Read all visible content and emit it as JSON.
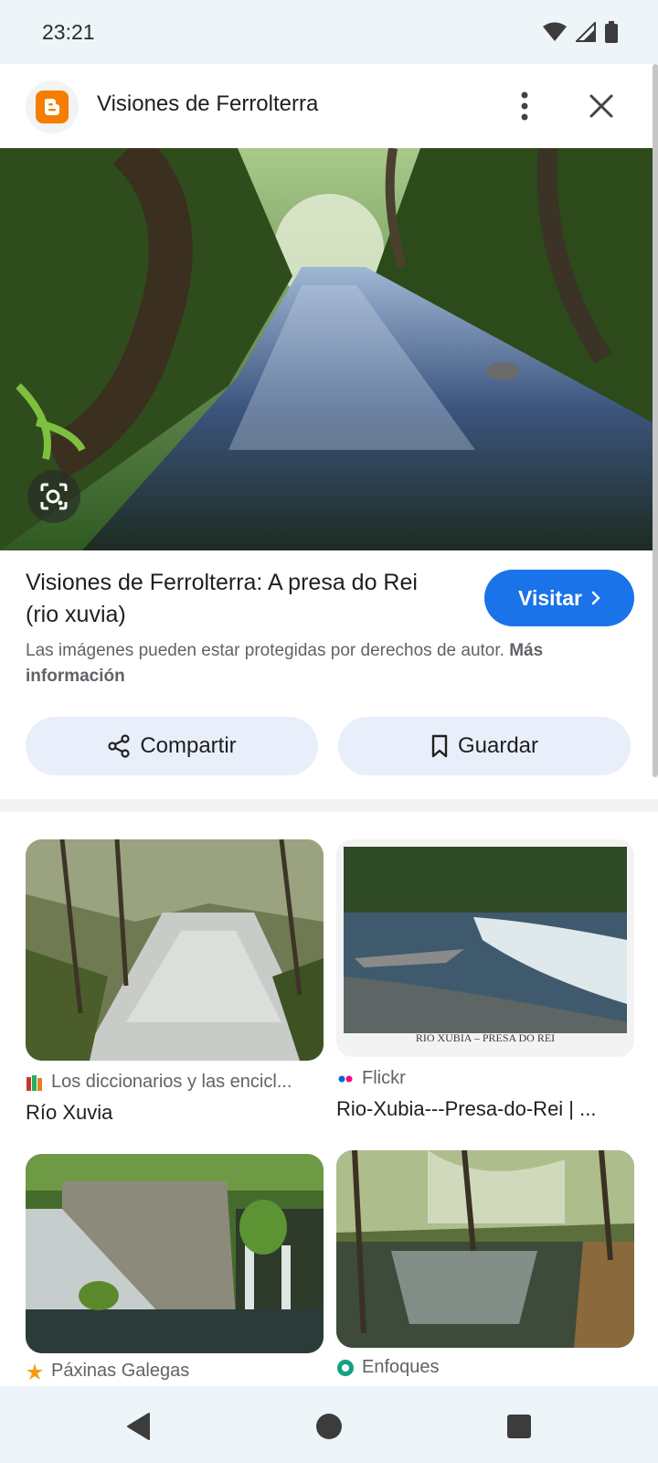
{
  "status_bar": {
    "time": "23:21",
    "icons": [
      "wifi-icon",
      "signal-icon",
      "battery-icon"
    ]
  },
  "header": {
    "site_name": "Visiones de Ferrolterra",
    "favicon": "blogger-icon",
    "more_icon": "more-vert-icon",
    "close_icon": "close-icon"
  },
  "result": {
    "title": "Visiones de Ferrolterra: A presa do Rei (rio xuvia)",
    "visit_label": "Visitar",
    "copyright_text": "Las imágenes pueden estar protegidas por derechos de autor.",
    "more_info_label": "Más información",
    "share_label": "Compartir",
    "save_label": "Guardar"
  },
  "related": [
    {
      "source": "Los diccionarios y las encicl...",
      "source_icon": "books-icon",
      "title": "Río Xuvia"
    },
    {
      "source": "Flickr",
      "source_icon": "flickr-icon",
      "title": "Rio-Xubia---Presa-do-Rei | ...",
      "image_caption": "RIO XUBIA – PRESA DO REI"
    },
    {
      "source": "Páxinas Galegas",
      "source_icon": "star-icon",
      "title": ""
    },
    {
      "source": "Enfoques",
      "source_icon": "enfoques-icon",
      "title": ""
    }
  ],
  "colors": {
    "accent": "#1a73e8",
    "blogger": "#f57d00",
    "button_bg": "#e8effb",
    "system_bar": "#eef5f9"
  }
}
